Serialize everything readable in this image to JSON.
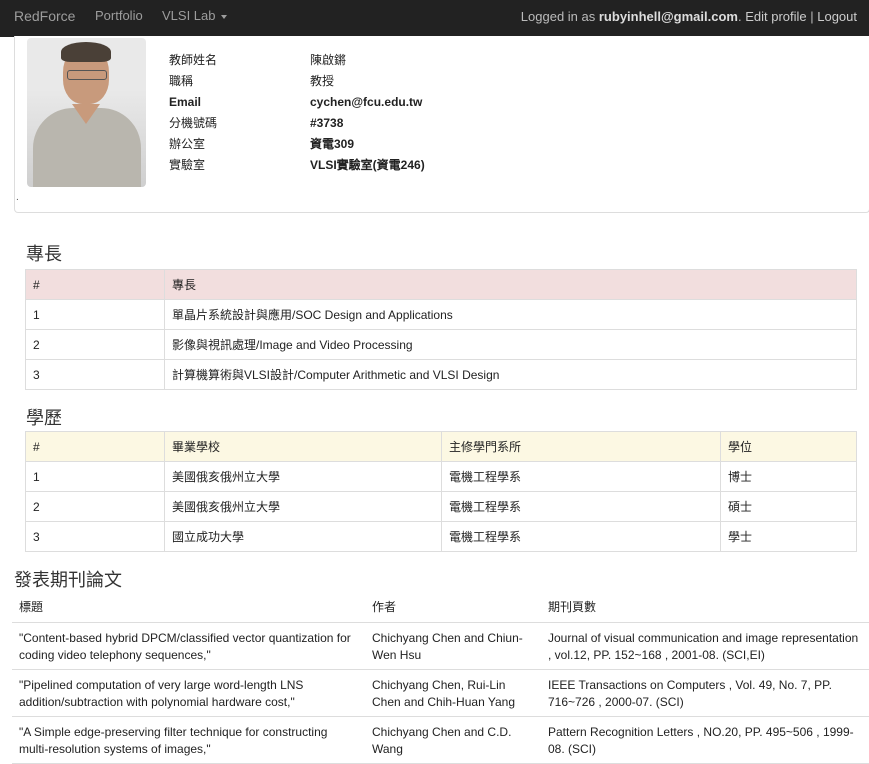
{
  "navbar": {
    "brand": "RedForce",
    "portfolio": "Portfolio",
    "lab": "VLSI Lab",
    "logged_in_prefix": "Logged in as ",
    "user_email": "rubyinhell@gmail.com",
    "edit_profile": "Edit profile",
    "separator": " | ",
    "logout": "Logout"
  },
  "profile": {
    "photo_icon": "teacher-portrait",
    "fields": [
      {
        "label": "教師姓名",
        "value": "陳啟鏘"
      },
      {
        "label": "職稱",
        "value": "教授"
      },
      {
        "label": "Email",
        "value": "cychen@fcu.edu.tw"
      },
      {
        "label": "分機號碼",
        "value": "#3738"
      },
      {
        "label": "辦公室",
        "value": "資電309"
      },
      {
        "label": "實驗室",
        "value": "VLSI實驗室(資電246)"
      }
    ],
    "dot": "."
  },
  "skills": {
    "heading": "專長",
    "columns": [
      "#",
      "專長"
    ],
    "rows": [
      [
        "1",
        "單晶片系統設計與應用/SOC Design and Applications"
      ],
      [
        "2",
        "影像與視訊處理/Image and Video Processing"
      ],
      [
        "3",
        "計算機算術與VLSI設計/Computer Arithmetic and VLSI Design"
      ]
    ]
  },
  "education": {
    "heading": "學歷",
    "columns": [
      "#",
      "畢業學校",
      "主修學門系所",
      "學位"
    ],
    "rows": [
      [
        "1",
        "美國俄亥俄州立大學",
        "電機工程學系",
        "博士"
      ],
      [
        "2",
        "美國俄亥俄州立大學",
        "電機工程學系",
        "碩士"
      ],
      [
        "3",
        "國立成功大學",
        "電機工程學系",
        "學士"
      ]
    ]
  },
  "publications": {
    "heading": "發表期刊論文",
    "columns": [
      "標題",
      "作者",
      "期刊頁數"
    ],
    "rows": [
      [
        "\"Content-based hybrid DPCM/classified vector quantization for coding video telephony sequences,\"",
        "Chichyang Chen and Chiun-Wen Hsu",
        "Journal of visual communication and image representation , vol.12, PP. 152~168 , 2001-08. (SCI,EI)"
      ],
      [
        "\"Pipelined computation of very large word-length LNS addition/subtraction with polynomial hardware cost,\"",
        "Chichyang Chen, Rui-Lin Chen and Chih-Huan Yang",
        "IEEE Transactions on Computers , Vol. 49, No. 7, PP. 716~726 , 2000-07. (SCI)"
      ],
      [
        "\"A Simple edge-preserving filter technique for constructing multi-resolution systems of images,\"",
        "Chichyang Chen and C.D. Wang",
        "Pattern Recognition Letters , NO.20, PP. 495~506 , 1999-08. (SCI)"
      ]
    ]
  }
}
